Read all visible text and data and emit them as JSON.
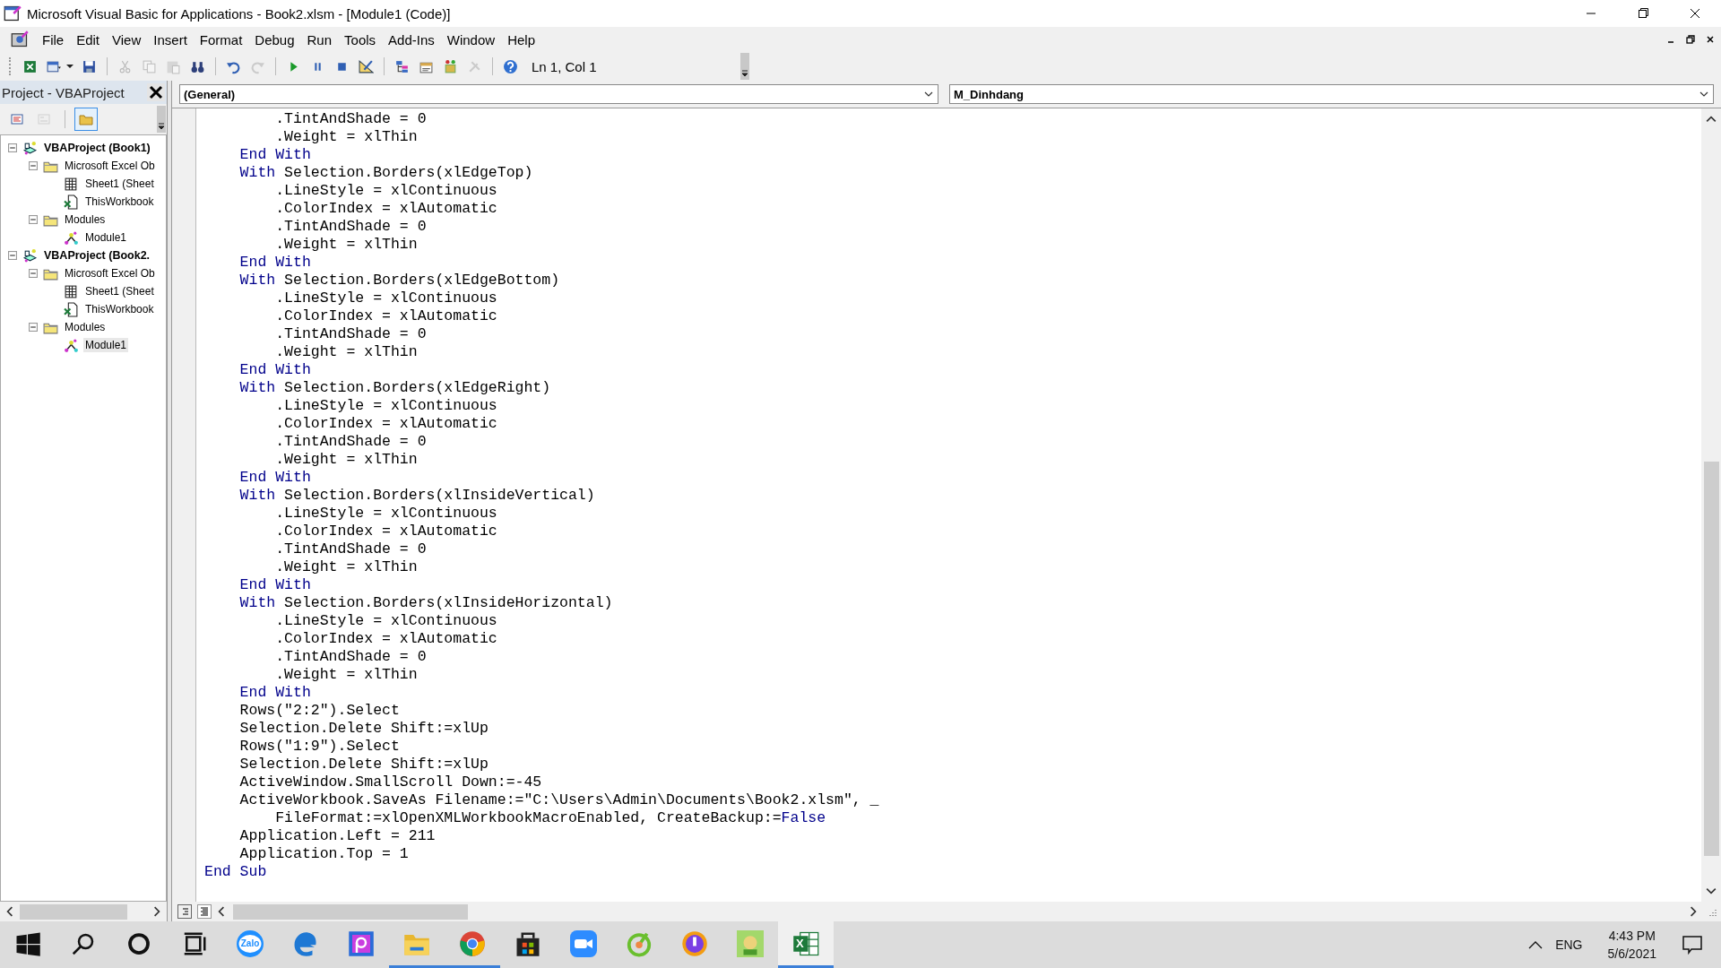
{
  "window": {
    "title": "Microsoft Visual Basic for Applications - Book2.xlsm - [Module1 (Code)]"
  },
  "menu": [
    "File",
    "Edit",
    "View",
    "Insert",
    "Format",
    "Debug",
    "Run",
    "Tools",
    "Add-Ins",
    "Window",
    "Help"
  ],
  "toolbar": {
    "groups": [
      [
        {
          "kind": "excel",
          "disabled": false
        },
        {
          "kind": "userform",
          "disabled": false
        },
        {
          "kind": "save",
          "disabled": false
        }
      ],
      [
        {
          "kind": "cut",
          "disabled": true
        },
        {
          "kind": "copy",
          "disabled": true
        },
        {
          "kind": "paste",
          "disabled": true
        },
        {
          "kind": "find",
          "disabled": false
        }
      ],
      [
        {
          "kind": "undo",
          "disabled": false
        },
        {
          "kind": "redo",
          "disabled": true
        }
      ],
      [
        {
          "kind": "run",
          "disabled": false
        },
        {
          "kind": "break",
          "disabled": false
        },
        {
          "kind": "reset",
          "disabled": false
        },
        {
          "kind": "design",
          "disabled": false
        }
      ],
      [
        {
          "kind": "project",
          "disabled": false
        },
        {
          "kind": "properties",
          "disabled": false
        },
        {
          "kind": "browser",
          "disabled": false
        },
        {
          "kind": "toolbox",
          "disabled": true
        }
      ],
      [
        {
          "kind": "help",
          "disabled": false
        }
      ]
    ],
    "position": "Ln 1, Col 1"
  },
  "project_panel": {
    "title": "Project - VBAProject",
    "buttons": [
      {
        "kind": "view-code",
        "disabled": false,
        "selected": false
      },
      {
        "kind": "view-object",
        "disabled": true,
        "selected": false
      },
      {
        "kind": "toggle-folders",
        "disabled": false,
        "selected": true
      }
    ],
    "tree": [
      {
        "label": "VBAProject (Book1)",
        "kind": "project",
        "expanded": true,
        "selected": false,
        "children": [
          {
            "label": "Microsoft Excel Ob",
            "kind": "folder",
            "expanded": true,
            "selected": false,
            "children": [
              {
                "label": "Sheet1 (Sheet",
                "kind": "sheet",
                "selected": false
              },
              {
                "label": "ThisWorkbook",
                "kind": "workbook",
                "selected": false
              }
            ]
          },
          {
            "label": "Modules",
            "kind": "folder",
            "expanded": true,
            "selected": false,
            "children": [
              {
                "label": "Module1",
                "kind": "module",
                "selected": false
              }
            ]
          }
        ]
      },
      {
        "label": "VBAProject (Book2.",
        "kind": "project",
        "expanded": true,
        "selected": false,
        "children": [
          {
            "label": "Microsoft Excel Ob",
            "kind": "folder",
            "expanded": true,
            "selected": false,
            "children": [
              {
                "label": "Sheet1 (Sheet",
                "kind": "sheet",
                "selected": false
              },
              {
                "label": "ThisWorkbook",
                "kind": "workbook",
                "selected": false
              }
            ]
          },
          {
            "label": "Modules",
            "kind": "folder",
            "expanded": true,
            "selected": false,
            "children": [
              {
                "label": "Module1",
                "kind": "module",
                "selected": true
              }
            ]
          }
        ]
      }
    ]
  },
  "code_window": {
    "object_dropdown": "(General)",
    "procedure_dropdown": "M_Dinhdang",
    "lines": [
      [
        {
          "text": "        .TintAndShade = 0",
          "kind": "plain"
        }
      ],
      [
        {
          "text": "        .Weight = xlThin",
          "kind": "plain"
        }
      ],
      [
        {
          "text": "    End With",
          "kind": "keyword"
        }
      ],
      [
        {
          "text": "    With",
          "kind": "keyword"
        },
        {
          "text": " Selection.Borders(xlEdgeTop)",
          "kind": "plain"
        }
      ],
      [
        {
          "text": "        .LineStyle = xlContinuous",
          "kind": "plain"
        }
      ],
      [
        {
          "text": "        .ColorIndex = xlAutomatic",
          "kind": "plain"
        }
      ],
      [
        {
          "text": "        .TintAndShade = 0",
          "kind": "plain"
        }
      ],
      [
        {
          "text": "        .Weight = xlThin",
          "kind": "plain"
        }
      ],
      [
        {
          "text": "    End With",
          "kind": "keyword"
        }
      ],
      [
        {
          "text": "    With",
          "kind": "keyword"
        },
        {
          "text": " Selection.Borders(xlEdgeBottom)",
          "kind": "plain"
        }
      ],
      [
        {
          "text": "        .LineStyle = xlContinuous",
          "kind": "plain"
        }
      ],
      [
        {
          "text": "        .ColorIndex = xlAutomatic",
          "kind": "plain"
        }
      ],
      [
        {
          "text": "        .TintAndShade = 0",
          "kind": "plain"
        }
      ],
      [
        {
          "text": "        .Weight = xlThin",
          "kind": "plain"
        }
      ],
      [
        {
          "text": "    End With",
          "kind": "keyword"
        }
      ],
      [
        {
          "text": "    With",
          "kind": "keyword"
        },
        {
          "text": " Selection.Borders(xlEdgeRight)",
          "kind": "plain"
        }
      ],
      [
        {
          "text": "        .LineStyle = xlContinuous",
          "kind": "plain"
        }
      ],
      [
        {
          "text": "        .ColorIndex = xlAutomatic",
          "kind": "plain"
        }
      ],
      [
        {
          "text": "        .TintAndShade = 0",
          "kind": "plain"
        }
      ],
      [
        {
          "text": "        .Weight = xlThin",
          "kind": "plain"
        }
      ],
      [
        {
          "text": "    End With",
          "kind": "keyword"
        }
      ],
      [
        {
          "text": "    With",
          "kind": "keyword"
        },
        {
          "text": " Selection.Borders(xlInsideVertical)",
          "kind": "plain"
        }
      ],
      [
        {
          "text": "        .LineStyle = xlContinuous",
          "kind": "plain"
        }
      ],
      [
        {
          "text": "        .ColorIndex = xlAutomatic",
          "kind": "plain"
        }
      ],
      [
        {
          "text": "        .TintAndShade = 0",
          "kind": "plain"
        }
      ],
      [
        {
          "text": "        .Weight = xlThin",
          "kind": "plain"
        }
      ],
      [
        {
          "text": "    End With",
          "kind": "keyword"
        }
      ],
      [
        {
          "text": "    With",
          "kind": "keyword"
        },
        {
          "text": " Selection.Borders(xlInsideHorizontal)",
          "kind": "plain"
        }
      ],
      [
        {
          "text": "        .LineStyle = xlContinuous",
          "kind": "plain"
        }
      ],
      [
        {
          "text": "        .ColorIndex = xlAutomatic",
          "kind": "plain"
        }
      ],
      [
        {
          "text": "        .TintAndShade = 0",
          "kind": "plain"
        }
      ],
      [
        {
          "text": "        .Weight = xlThin",
          "kind": "plain"
        }
      ],
      [
        {
          "text": "    End With",
          "kind": "keyword"
        }
      ],
      [
        {
          "text": "    Rows(\"2:2\").Select",
          "kind": "plain"
        }
      ],
      [
        {
          "text": "    Selection.Delete Shift:=xlUp",
          "kind": "plain"
        }
      ],
      [
        {
          "text": "    Rows(\"1:9\").Select",
          "kind": "plain"
        }
      ],
      [
        {
          "text": "    Selection.Delete Shift:=xlUp",
          "kind": "plain"
        }
      ],
      [
        {
          "text": "    ActiveWindow.SmallScroll Down:=-45",
          "kind": "plain"
        }
      ],
      [
        {
          "text": "    ActiveWorkbook.SaveAs Filename:=\"C:\\Users\\Admin\\Documents\\Book2.xlsm\", _",
          "kind": "plain"
        }
      ],
      [
        {
          "text": "        FileFormat:=xlOpenXMLWorkbookMacroEnabled, CreateBackup:=",
          "kind": "plain"
        },
        {
          "text": "False",
          "kind": "keyword"
        }
      ],
      [
        {
          "text": "    Application.Left = 211",
          "kind": "plain"
        }
      ],
      [
        {
          "text": "    Application.Top = 1",
          "kind": "plain"
        }
      ],
      [
        {
          "text": "End Sub",
          "kind": "keyword"
        }
      ]
    ]
  },
  "taskbar": {
    "apps": [
      {
        "kind": "start",
        "running": false,
        "active": false
      },
      {
        "kind": "search",
        "running": false,
        "active": false
      },
      {
        "kind": "cortana",
        "running": false,
        "active": false
      },
      {
        "kind": "taskview",
        "running": false,
        "active": false
      },
      {
        "kind": "chat",
        "label": "Zalo",
        "running": false,
        "active": false
      },
      {
        "kind": "edge",
        "running": false,
        "active": false
      },
      {
        "kind": "picsart",
        "running": false,
        "active": false
      },
      {
        "kind": "explorer",
        "running": true,
        "active": false
      },
      {
        "kind": "chrome",
        "running": true,
        "active": false
      },
      {
        "kind": "store",
        "running": false,
        "active": false
      },
      {
        "kind": "camera",
        "running": false,
        "active": false
      },
      {
        "kind": "leaf",
        "running": false,
        "active": false
      },
      {
        "kind": "shield",
        "running": false,
        "active": false
      },
      {
        "kind": "game",
        "running": false,
        "active": false
      },
      {
        "kind": "excel",
        "label": "X",
        "running": true,
        "active": true
      }
    ],
    "language": "ENG",
    "time": "4:43 PM",
    "date": "5/6/2021"
  }
}
